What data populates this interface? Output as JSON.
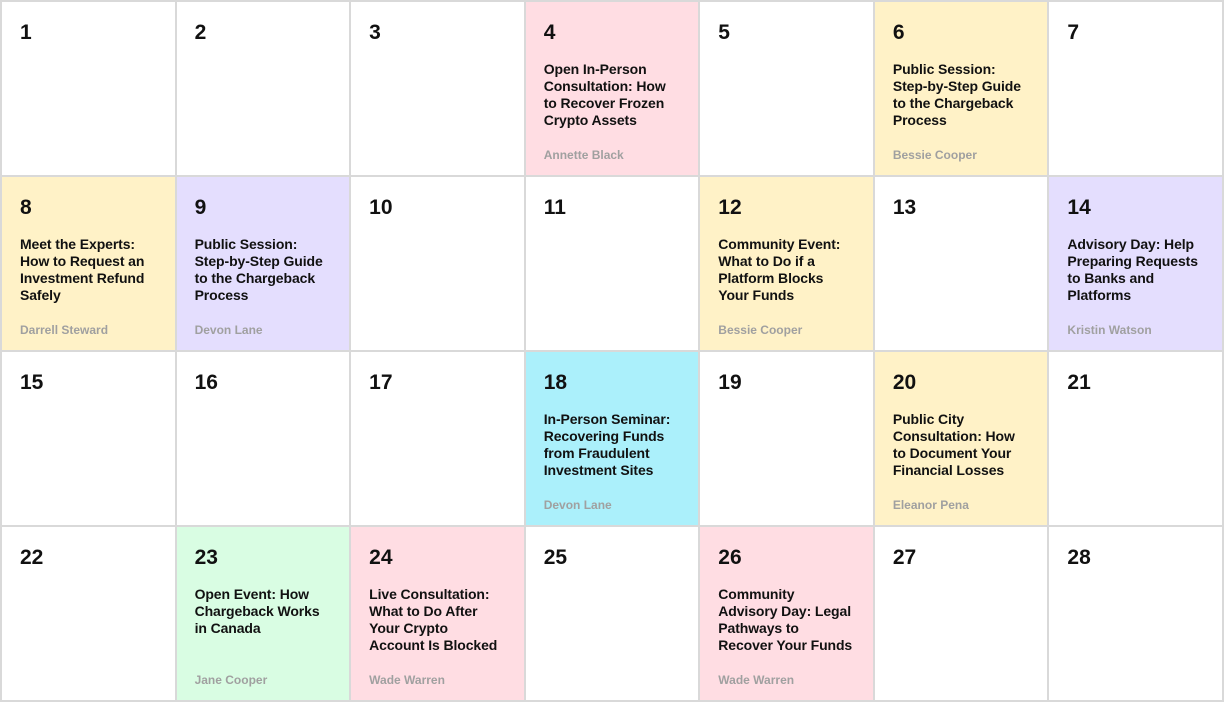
{
  "calendar": {
    "days": [
      {
        "number": "1"
      },
      {
        "number": "2"
      },
      {
        "number": "3"
      },
      {
        "number": "4",
        "title": "Open In-Person Consultation: How to Recover Frozen Crypto Assets",
        "host": "Annette Black",
        "color": "#ffdde3"
      },
      {
        "number": "5"
      },
      {
        "number": "6",
        "title": "Public Session: Step-by-Step Guide to the Chargeback Process",
        "host": "Bessie Cooper",
        "color": "#fff2c7"
      },
      {
        "number": "7"
      },
      {
        "number": "8",
        "title": "Meet the Experts: How to Request an Investment Refund Safely",
        "host": "Darrell Steward",
        "color": "#fff2c7"
      },
      {
        "number": "9",
        "title": "Public Session: Step-by-Step Guide to the Chargeback Process",
        "host": "Devon Lane",
        "color": "#e4defe"
      },
      {
        "number": "10"
      },
      {
        "number": "11"
      },
      {
        "number": "12",
        "title": "Community Event: What to Do if a Platform Blocks Your Funds",
        "host": "Bessie Cooper",
        "color": "#fff2c7"
      },
      {
        "number": "13"
      },
      {
        "number": "14",
        "title": "Advisory Day: Help Preparing Requests to Banks and Platforms",
        "host": "Kristin Watson",
        "color": "#e4defe"
      },
      {
        "number": "15"
      },
      {
        "number": "16"
      },
      {
        "number": "17"
      },
      {
        "number": "18",
        "title": "In-Person Seminar: Recovering Funds from Fraudulent Investment Sites",
        "host": "Devon Lane",
        "color": "#abf0fb"
      },
      {
        "number": "19"
      },
      {
        "number": "20",
        "title": "Public City Consultation: How to Document Your Financial Losses",
        "host": "Eleanor Pena",
        "color": "#fff2c7"
      },
      {
        "number": "21"
      },
      {
        "number": "22"
      },
      {
        "number": "23",
        "title": "Open Event: How Chargeback Works in Canada",
        "host": "Jane Cooper",
        "color": "#d9fde3"
      },
      {
        "number": "24",
        "title": "Live Consultation: What to Do After Your Crypto Account Is Blocked",
        "host": "Wade Warren",
        "color": "#ffdde3"
      },
      {
        "number": "25"
      },
      {
        "number": "26",
        "title": "Community Advisory Day: Legal Pathways to Recover Your Funds",
        "host": "Wade Warren",
        "color": "#ffdde3"
      },
      {
        "number": "27"
      },
      {
        "number": "28"
      }
    ]
  }
}
